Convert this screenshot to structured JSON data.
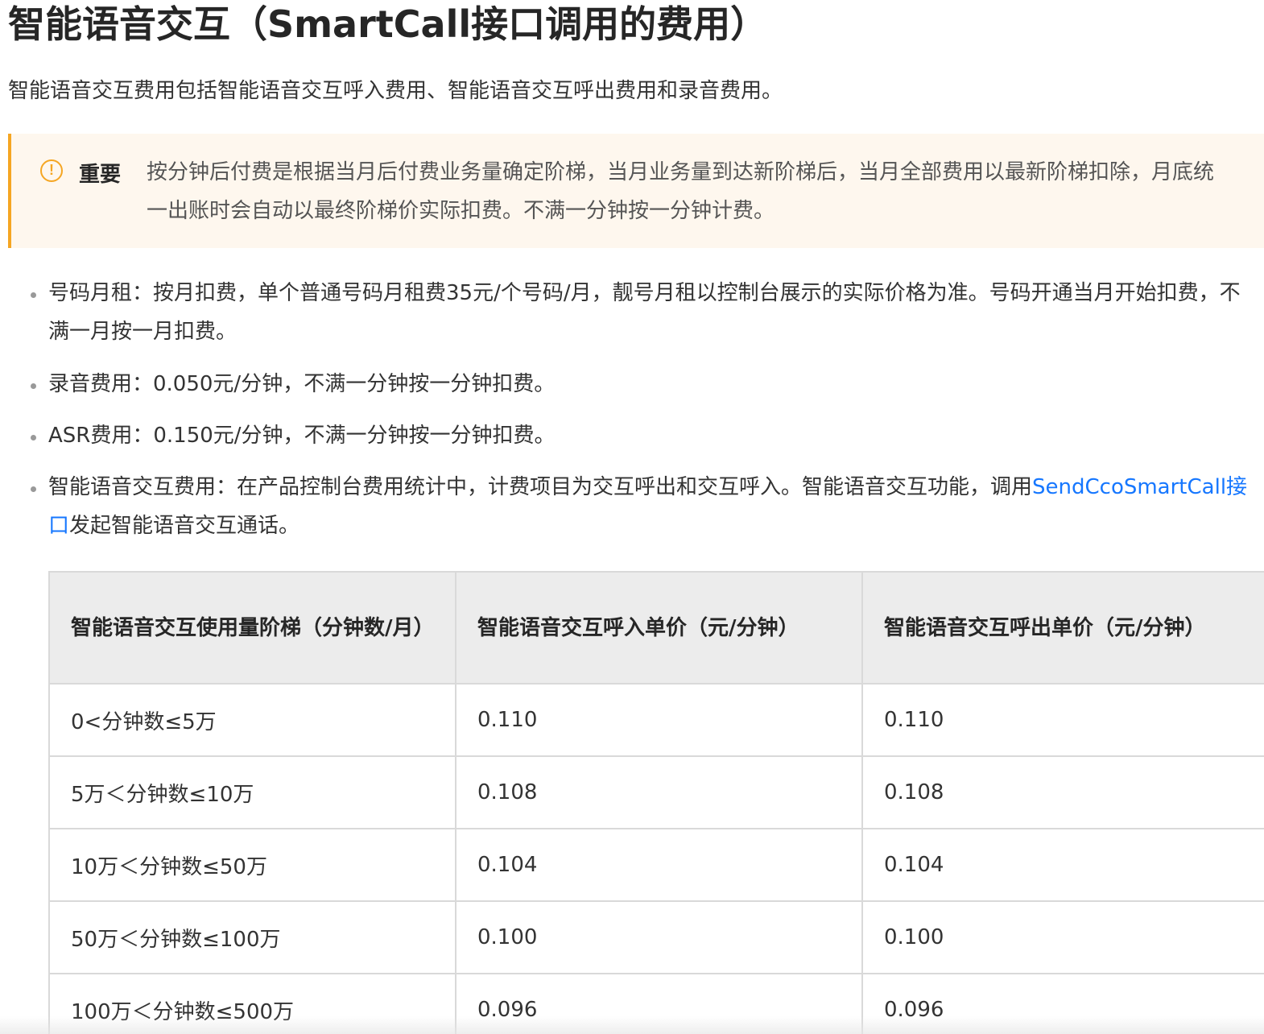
{
  "title": "智能语音交互（SmartCall接口调用的费用）",
  "intro": "智能语音交互费用包括智能语音交互呼入费用、智能语音交互呼出费用和录音费用。",
  "notice": {
    "icon": "exclamation-circle-icon",
    "label": "重要",
    "text": "按分钟后付费是根据当月后付费业务量确定阶梯，当月业务量到达新阶梯后，当月全部费用以最新阶梯扣除，月底统一出账时会自动以最终阶梯价实际扣费。不满一分钟按一分钟计费。",
    "accent_color": "#f5a623",
    "background_color": "#fef7ee"
  },
  "bullets": [
    {
      "text": "号码月租：按月扣费，单个普通号码月租费35元/个号码/月，靓号月租以控制台展示的实际价格为准。号码开通当月开始扣费，不满一月按一月扣费。"
    },
    {
      "text": "录音费用：0.050元/分钟，不满一分钟按一分钟扣费。"
    },
    {
      "text": "ASR费用：0.150元/分钟，不满一分钟按一分钟扣费。"
    },
    {
      "text_before": "智能语音交互费用：在产品控制台费用统计中，计费项目为交互呼出和交互呼入。智能语音交互功能，调用",
      "link_text": "SendCcoSmartCall接口",
      "text_after": "发起智能语音交互通话。"
    }
  ],
  "link_color": "#1677ff",
  "table": {
    "headers": [
      "智能语音交互使用量阶梯（分钟数/月）",
      "智能语音交互呼入单价（元/分钟）",
      "智能语音交互呼出单价（元/分钟）"
    ],
    "rows": [
      [
        "0<分钟数≤5万",
        "0.110",
        "0.110"
      ],
      [
        "5万＜分钟数≤10万",
        "0.108",
        "0.108"
      ],
      [
        "10万＜分钟数≤50万",
        "0.104",
        "0.104"
      ],
      [
        "50万＜分钟数≤100万",
        "0.100",
        "0.100"
      ],
      [
        "100万＜分钟数≤500万",
        "0.096",
        "0.096"
      ]
    ]
  }
}
